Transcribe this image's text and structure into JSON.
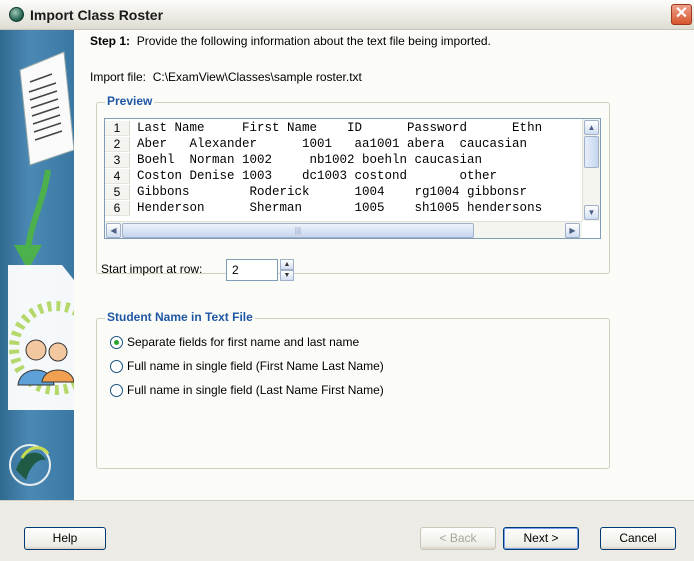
{
  "window": {
    "title": "Import Class Roster"
  },
  "step": {
    "label": "Step 1:",
    "text": "Provide the following information about the text file being imported."
  },
  "import_file": {
    "label": "Import file:",
    "path": "C:\\ExamView\\Classes\\sample roster.txt"
  },
  "preview": {
    "title": "Preview",
    "rows": [
      {
        "num": "1",
        "text": "Last Name     First Name    ID      Password      Ethn"
      },
      {
        "num": "2",
        "text": "Aber   Alexander      1001   aa1001 abera  caucasian"
      },
      {
        "num": "3",
        "text": "Boehl  Norman 1002     nb1002 boehln caucasian"
      },
      {
        "num": "4",
        "text": "Coston Denise 1003    dc1003 costond       other"
      },
      {
        "num": "5",
        "text": "Gibbons        Roderick      1004    rg1004 gibbonsr"
      },
      {
        "num": "6",
        "text": "Henderson      Sherman       1005    sh1005 hendersons"
      }
    ]
  },
  "start_row": {
    "label": "Start import at row:",
    "value": "2"
  },
  "name_section": {
    "title": "Student Name in Text File",
    "options": [
      {
        "label": "Separate fields for first name and last name",
        "selected": true
      },
      {
        "label": "Full name in single field (First Name Last Name)",
        "selected": false
      },
      {
        "label": "Full name in single field (Last Name First Name)",
        "selected": false
      }
    ]
  },
  "buttons": {
    "help": "Help",
    "back": "< Back",
    "next": "Next >",
    "cancel": "Cancel"
  },
  "colors": {
    "accent": "#1f57a4",
    "sidebar": "#3a78a3",
    "radio_selected": "#2aa32a"
  }
}
